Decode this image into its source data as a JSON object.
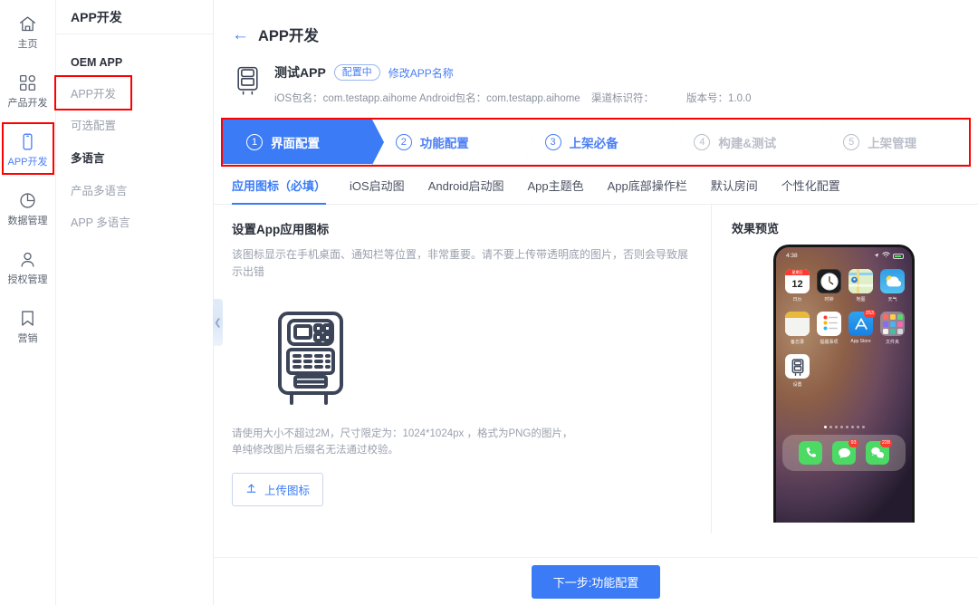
{
  "rail": {
    "items": [
      {
        "label": "主页",
        "icon": "home-icon",
        "active": false
      },
      {
        "label": "产品开发",
        "icon": "grid-blocks-icon",
        "active": false
      },
      {
        "label": "APP开发",
        "icon": "phone-icon",
        "active": true
      },
      {
        "label": "数据管理",
        "icon": "pie-chart-icon",
        "active": false
      },
      {
        "label": "授权管理",
        "icon": "user-icon",
        "active": false
      },
      {
        "label": "营销",
        "icon": "bookmark-icon",
        "active": false
      }
    ]
  },
  "subnav": {
    "title": "APP开发",
    "groups": [
      {
        "group": "OEM APP",
        "items": [
          "APP开发",
          "可选配置"
        ]
      },
      {
        "group": "多语言",
        "items": [
          "产品多语言",
          "APP 多语言"
        ]
      }
    ],
    "selected": "APP开发",
    "collapse_icon": "chevron-left-icon"
  },
  "page": {
    "back_icon": "arrow-left-icon",
    "title": "APP开发"
  },
  "app_summary": {
    "thumb_icon": "app-placeholder-icon",
    "name": "测试APP",
    "status_badge": "配置中",
    "rename_link": "修改APP名称",
    "fields": [
      {
        "label": "iOS包名：",
        "value": "com.testapp.aihome"
      },
      {
        "label": "Android包名：",
        "value": "com.testapp.aihome"
      },
      {
        "label": "渠道标识符：",
        "value": ""
      },
      {
        "label": "版本号：",
        "value": "1.0.0"
      }
    ]
  },
  "stepper": {
    "steps": [
      {
        "num": "1",
        "label": "界面配置",
        "state": "active"
      },
      {
        "num": "2",
        "label": "功能配置",
        "state": "done"
      },
      {
        "num": "3",
        "label": "上架必备",
        "state": "done"
      },
      {
        "num": "4",
        "label": "构建&测试",
        "state": "muted"
      },
      {
        "num": "5",
        "label": "上架管理",
        "state": "muted"
      }
    ]
  },
  "tabs": {
    "items": [
      "应用图标（必填）",
      "iOS启动图",
      "Android启动图",
      "App主题色",
      "App底部操作栏",
      "默认房间",
      "个性化配置"
    ],
    "active_index": 0
  },
  "section": {
    "title": "设置App应用图标",
    "description": "该图标显示在手机桌面、通知栏等位置，非常重要。请不要上传带透明底的图片，否则会导致展示出错",
    "placeholder_icon": "app-placeholder-large-icon",
    "hint": "请使用大小不超过2M，尺寸限定为：1024*1024px ，格式为PNG的图片，单纯修改图片后缀名无法通过校验。",
    "upload_button": "上传图标",
    "upload_icon": "upload-icon"
  },
  "preview": {
    "title": "效果预览",
    "status_time": "4:38",
    "status_icons": [
      "location-icon",
      "wifi-icon",
      "battery-icon"
    ],
    "apps": [
      {
        "label": "日历",
        "icon": "calendar-icon",
        "day": "12",
        "month": "星期日",
        "badge": ""
      },
      {
        "label": "时钟",
        "icon": "clock-icon",
        "badge": ""
      },
      {
        "label": "地图",
        "icon": "maps-icon",
        "badge": ""
      },
      {
        "label": "天气",
        "icon": "weather-icon",
        "badge": ""
      },
      {
        "label": "备忘录",
        "icon": "notes-icon",
        "badge": ""
      },
      {
        "label": "提醒事项",
        "icon": "reminders-icon",
        "badge": ""
      },
      {
        "label": "App Store",
        "icon": "appstore-icon",
        "badge": "253"
      },
      {
        "label": "文件夹",
        "icon": "folder-icon",
        "badge": ""
      },
      {
        "label": "设置",
        "icon": "app-placeholder-icon",
        "badge": ""
      }
    ],
    "dock": [
      {
        "label": "电话",
        "icon": "phone-call-icon",
        "badge": ""
      },
      {
        "label": "信息",
        "icon": "messages-icon",
        "badge": "93"
      },
      {
        "label": "微信",
        "icon": "wechat-icon",
        "badge": "228"
      }
    ]
  },
  "footer": {
    "next_button": "下一步:功能配置"
  },
  "colors": {
    "accent": "#3b7cf6",
    "link": "#4a7ef5",
    "highlight_outline": "#ff0000",
    "muted_text": "#9aa1ad",
    "page_bg": "#f7f8fa"
  }
}
